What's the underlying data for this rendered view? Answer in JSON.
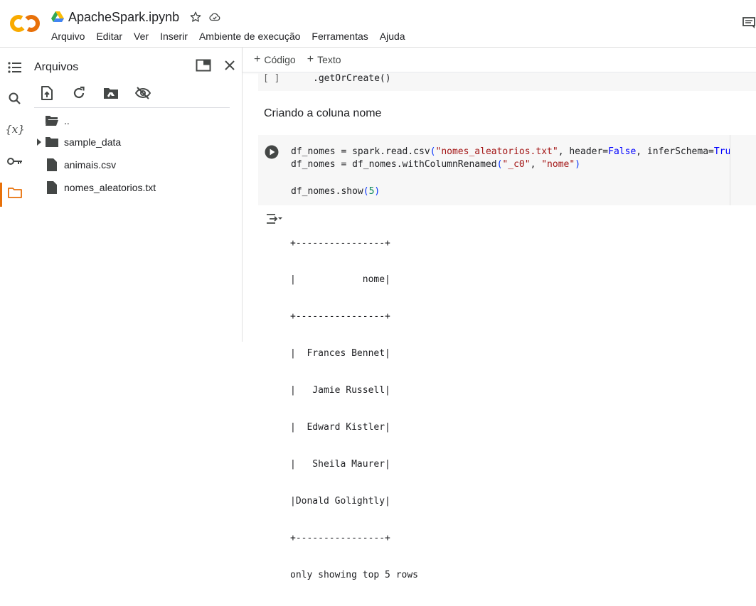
{
  "header": {
    "notebook_title": "ApacheSpark.ipynb",
    "menu": [
      "Arquivo",
      "Editar",
      "Ver",
      "Inserir",
      "Ambiente de execução",
      "Ferramentas",
      "Ajuda"
    ]
  },
  "files_panel": {
    "title": "Arquivos",
    "tree": [
      {
        "label": "..",
        "type": "parent-folder"
      },
      {
        "label": "sample_data",
        "type": "folder"
      },
      {
        "label": "animais.csv",
        "type": "file"
      },
      {
        "label": "nomes_aleatorios.txt",
        "type": "file"
      }
    ]
  },
  "notebook": {
    "toolbar": {
      "add_code": "Código",
      "add_text": "Texto"
    },
    "cell1": {
      "exec_count": "[ ]",
      "code": ".getOrCreate()"
    },
    "text_cell": "Criando a coluna nome",
    "cell2": {
      "line1": {
        "a": "df_nomes = spark.read.csv",
        "b": "\"nomes_aleatorios.txt\"",
        "c": ", header=",
        "d": "False",
        "e": ", inferSchema=",
        "f": "True"
      },
      "line2": {
        "a": "df_nomes = df_nomes.withColumnRenamed",
        "b": "\"_c0\"",
        "c": ", ",
        "d": "\"nome\""
      },
      "line3": {
        "a": "df_nomes.show",
        "b": "5"
      }
    },
    "output": [
      "+----------------+",
      "|            nome|",
      "+----------------+",
      "|  Frances Bennet|",
      "|   Jamie Russell|",
      "|  Edward Kistler|",
      "|   Sheila Maurer|",
      "|Donald Golightly|",
      "+----------------+",
      "only showing top 5 rows"
    ]
  },
  "colors": {
    "accent": "#e8710a",
    "string": "#a31515",
    "keyword": "#0000ff",
    "number": "#098658"
  }
}
